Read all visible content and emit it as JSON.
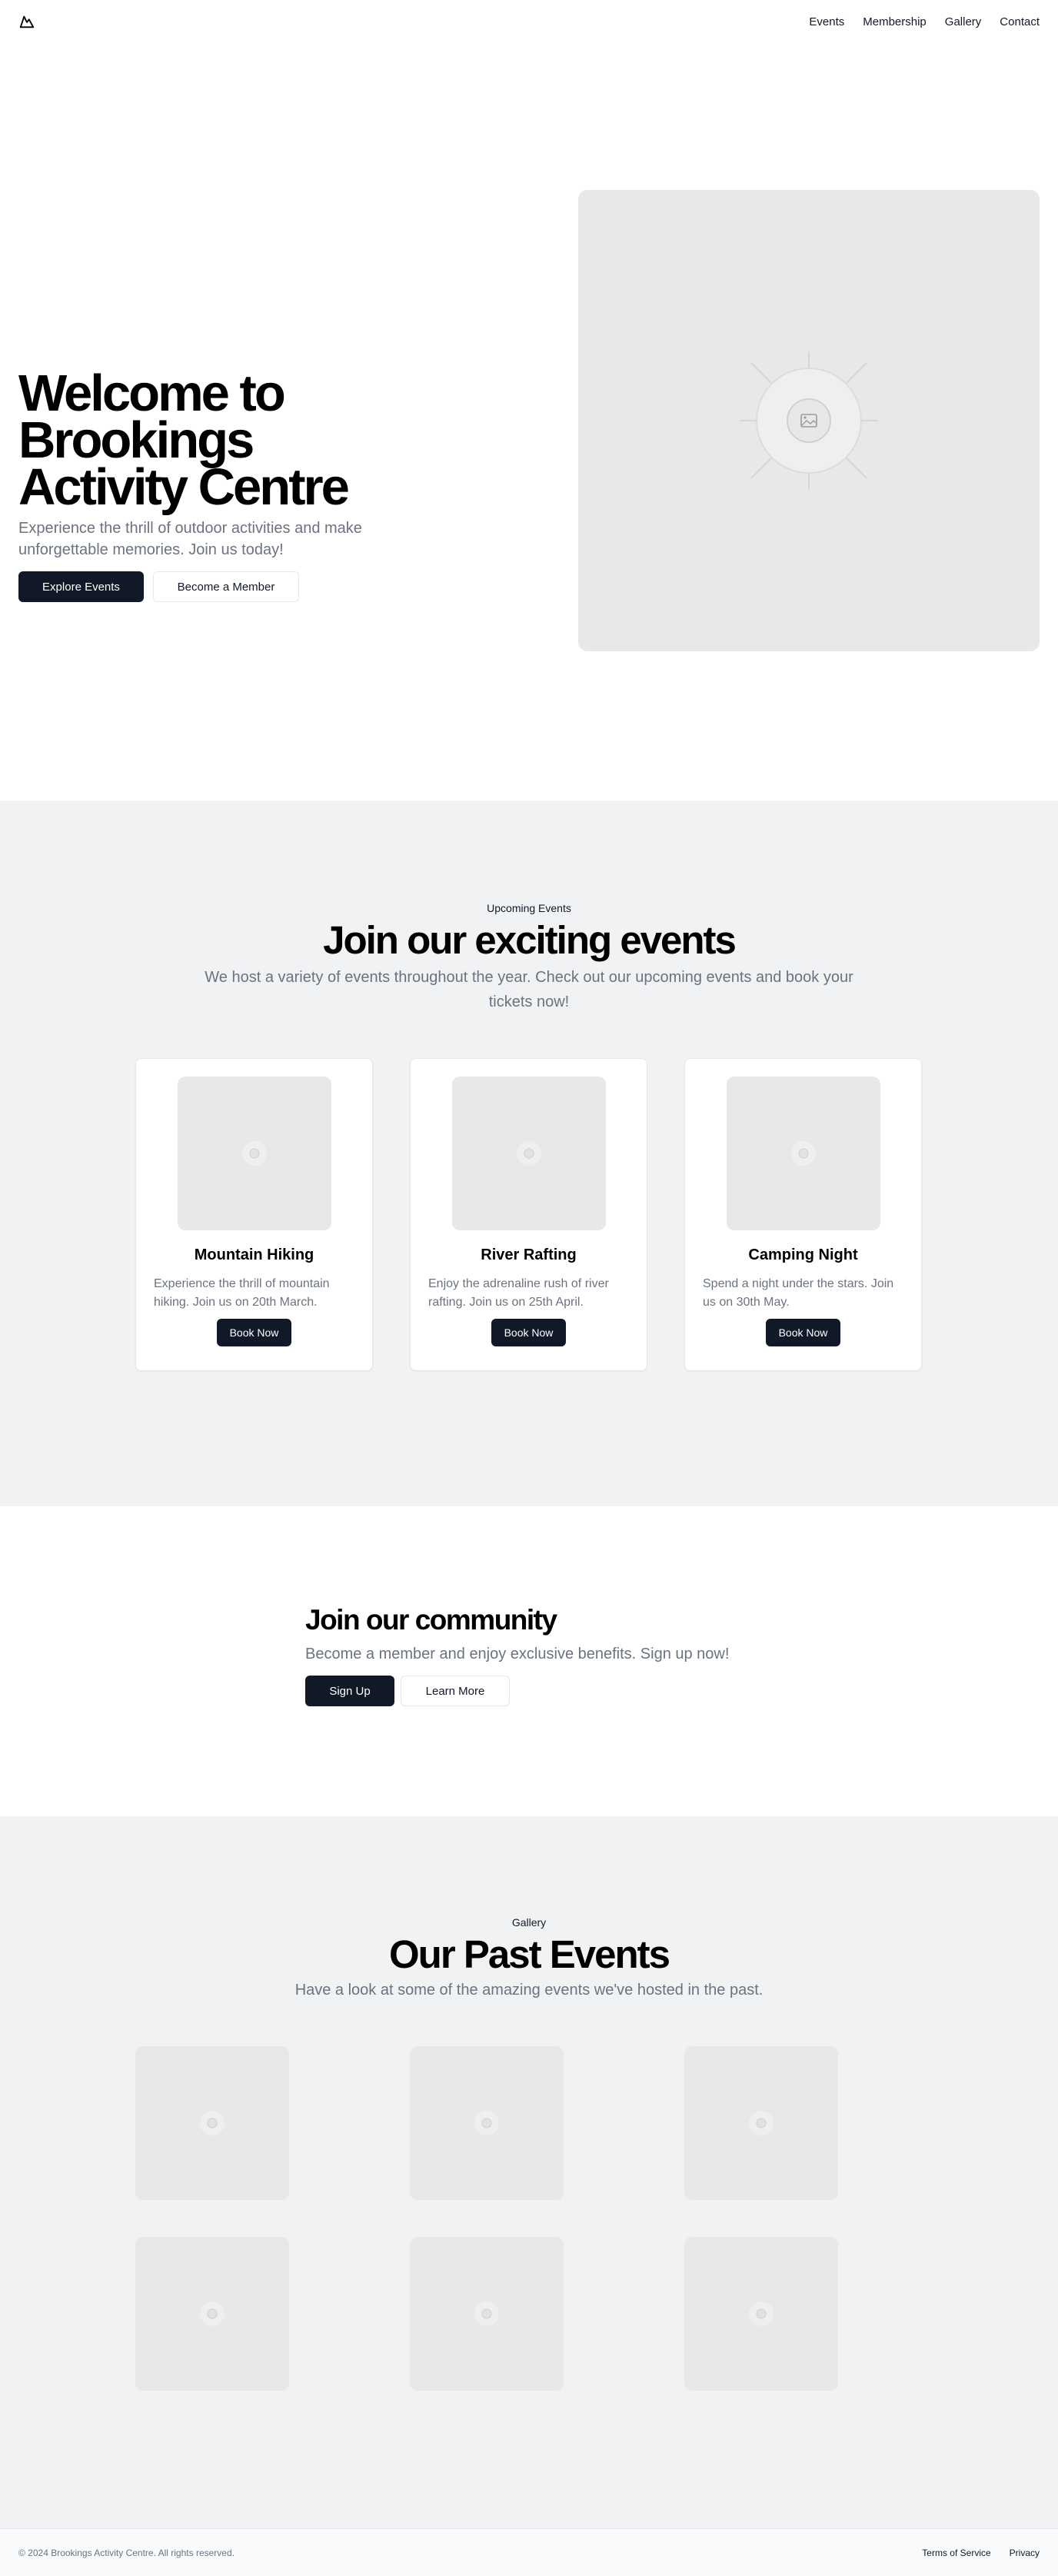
{
  "header": {
    "logo_icon": "mountain-icon",
    "nav": [
      {
        "label": "Events"
      },
      {
        "label": "Membership"
      },
      {
        "label": "Gallery"
      },
      {
        "label": "Contact"
      }
    ]
  },
  "hero": {
    "title_line1": "Welcome to Brookings",
    "title_line2": "Activity Centre",
    "subtitle": "Experience the thrill of outdoor activities and make unforgettable memories. Join us today!",
    "primary_button": "Explore Events",
    "secondary_button": "Become a Member",
    "image_icon": "image-placeholder-icon"
  },
  "events": {
    "eyebrow": "Upcoming Events",
    "title": "Join our exciting events",
    "subtitle": "We host a variety of events throughout the year. Check out our upcoming events and book your tickets now!",
    "cards": [
      {
        "title": "Mountain Hiking",
        "description": "Experience the thrill of mountain hiking. Join us on 20th March.",
        "button": "Book Now"
      },
      {
        "title": "River Rafting",
        "description": "Enjoy the adrenaline rush of river rafting. Join us on 25th April.",
        "button": "Book Now"
      },
      {
        "title": "Camping Night",
        "description": "Spend a night under the stars. Join us on 30th May.",
        "button": "Book Now"
      }
    ]
  },
  "community": {
    "title": "Join our community",
    "subtitle": "Become a member and enjoy exclusive benefits. Sign up now!",
    "primary_button": "Sign Up",
    "secondary_button": "Learn More"
  },
  "gallery": {
    "eyebrow": "Gallery",
    "title": "Our Past Events",
    "subtitle": "Have a look at some of the amazing events we've hosted in the past.",
    "image_count_icon": "image-placeholder-icon"
  },
  "footer": {
    "copyright": "© 2024 Brookings Activity Centre. All rights reserved.",
    "links": [
      {
        "label": "Terms of Service"
      },
      {
        "label": "Privacy"
      }
    ]
  },
  "colors": {
    "primary": "#111827",
    "muted_text": "#6b7280",
    "section_bg": "#f1f2f4",
    "placeholder_bg": "#e8e8e8"
  }
}
